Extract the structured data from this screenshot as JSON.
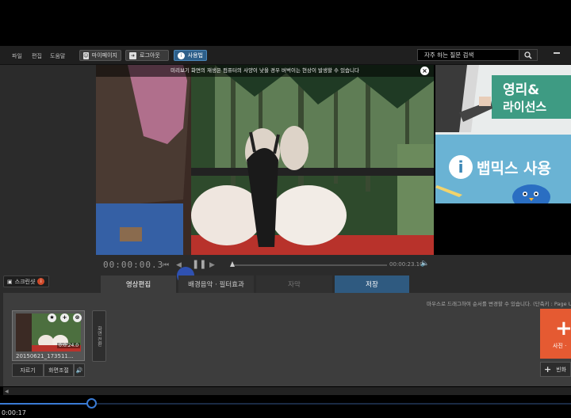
{
  "menu": {
    "file": "파일",
    "edit": "편집",
    "help": "도움말"
  },
  "toolbar": {
    "mypage": "마이페이지",
    "logout": "로그아웃",
    "usage": "사용법",
    "faq_label": "자주 하는 질문 검색"
  },
  "preview": {
    "notice": "미리보기 화면의 재생은 컴퓨터의 사양이 낮을 경우 버벅이는 현상이 발생할 수 있습니다",
    "timecode": "00:00:00.3",
    "duration": "00:00:23.10"
  },
  "ad": {
    "line1": "영리&",
    "line2": "라이선스",
    "line3": "뱁믹스 사용"
  },
  "snapshot": {
    "label": "스크린샷",
    "badge": "i"
  },
  "tabs": {
    "edit": "영상편집",
    "music": "배경음악 · 필터효과",
    "subtitle": "자막",
    "save": "저장"
  },
  "panel": {
    "hint": "마우스로 드래그하여 순서를 변경할 수 있습니다.  (단축키 : Page U",
    "clip": {
      "name": "20150621_173511...",
      "duration": "0:0:24.0",
      "cut": "자르기",
      "adjust": "화면조절"
    },
    "transition": "화면 전환",
    "add_photo": "사진 ·",
    "empty": "빈화"
  },
  "player": {
    "time": "0:00:17",
    "progress": 0.16
  },
  "colors": {
    "accent": "#2f5a80",
    "add": "#e55a32",
    "progress": "#3a7bd5"
  }
}
